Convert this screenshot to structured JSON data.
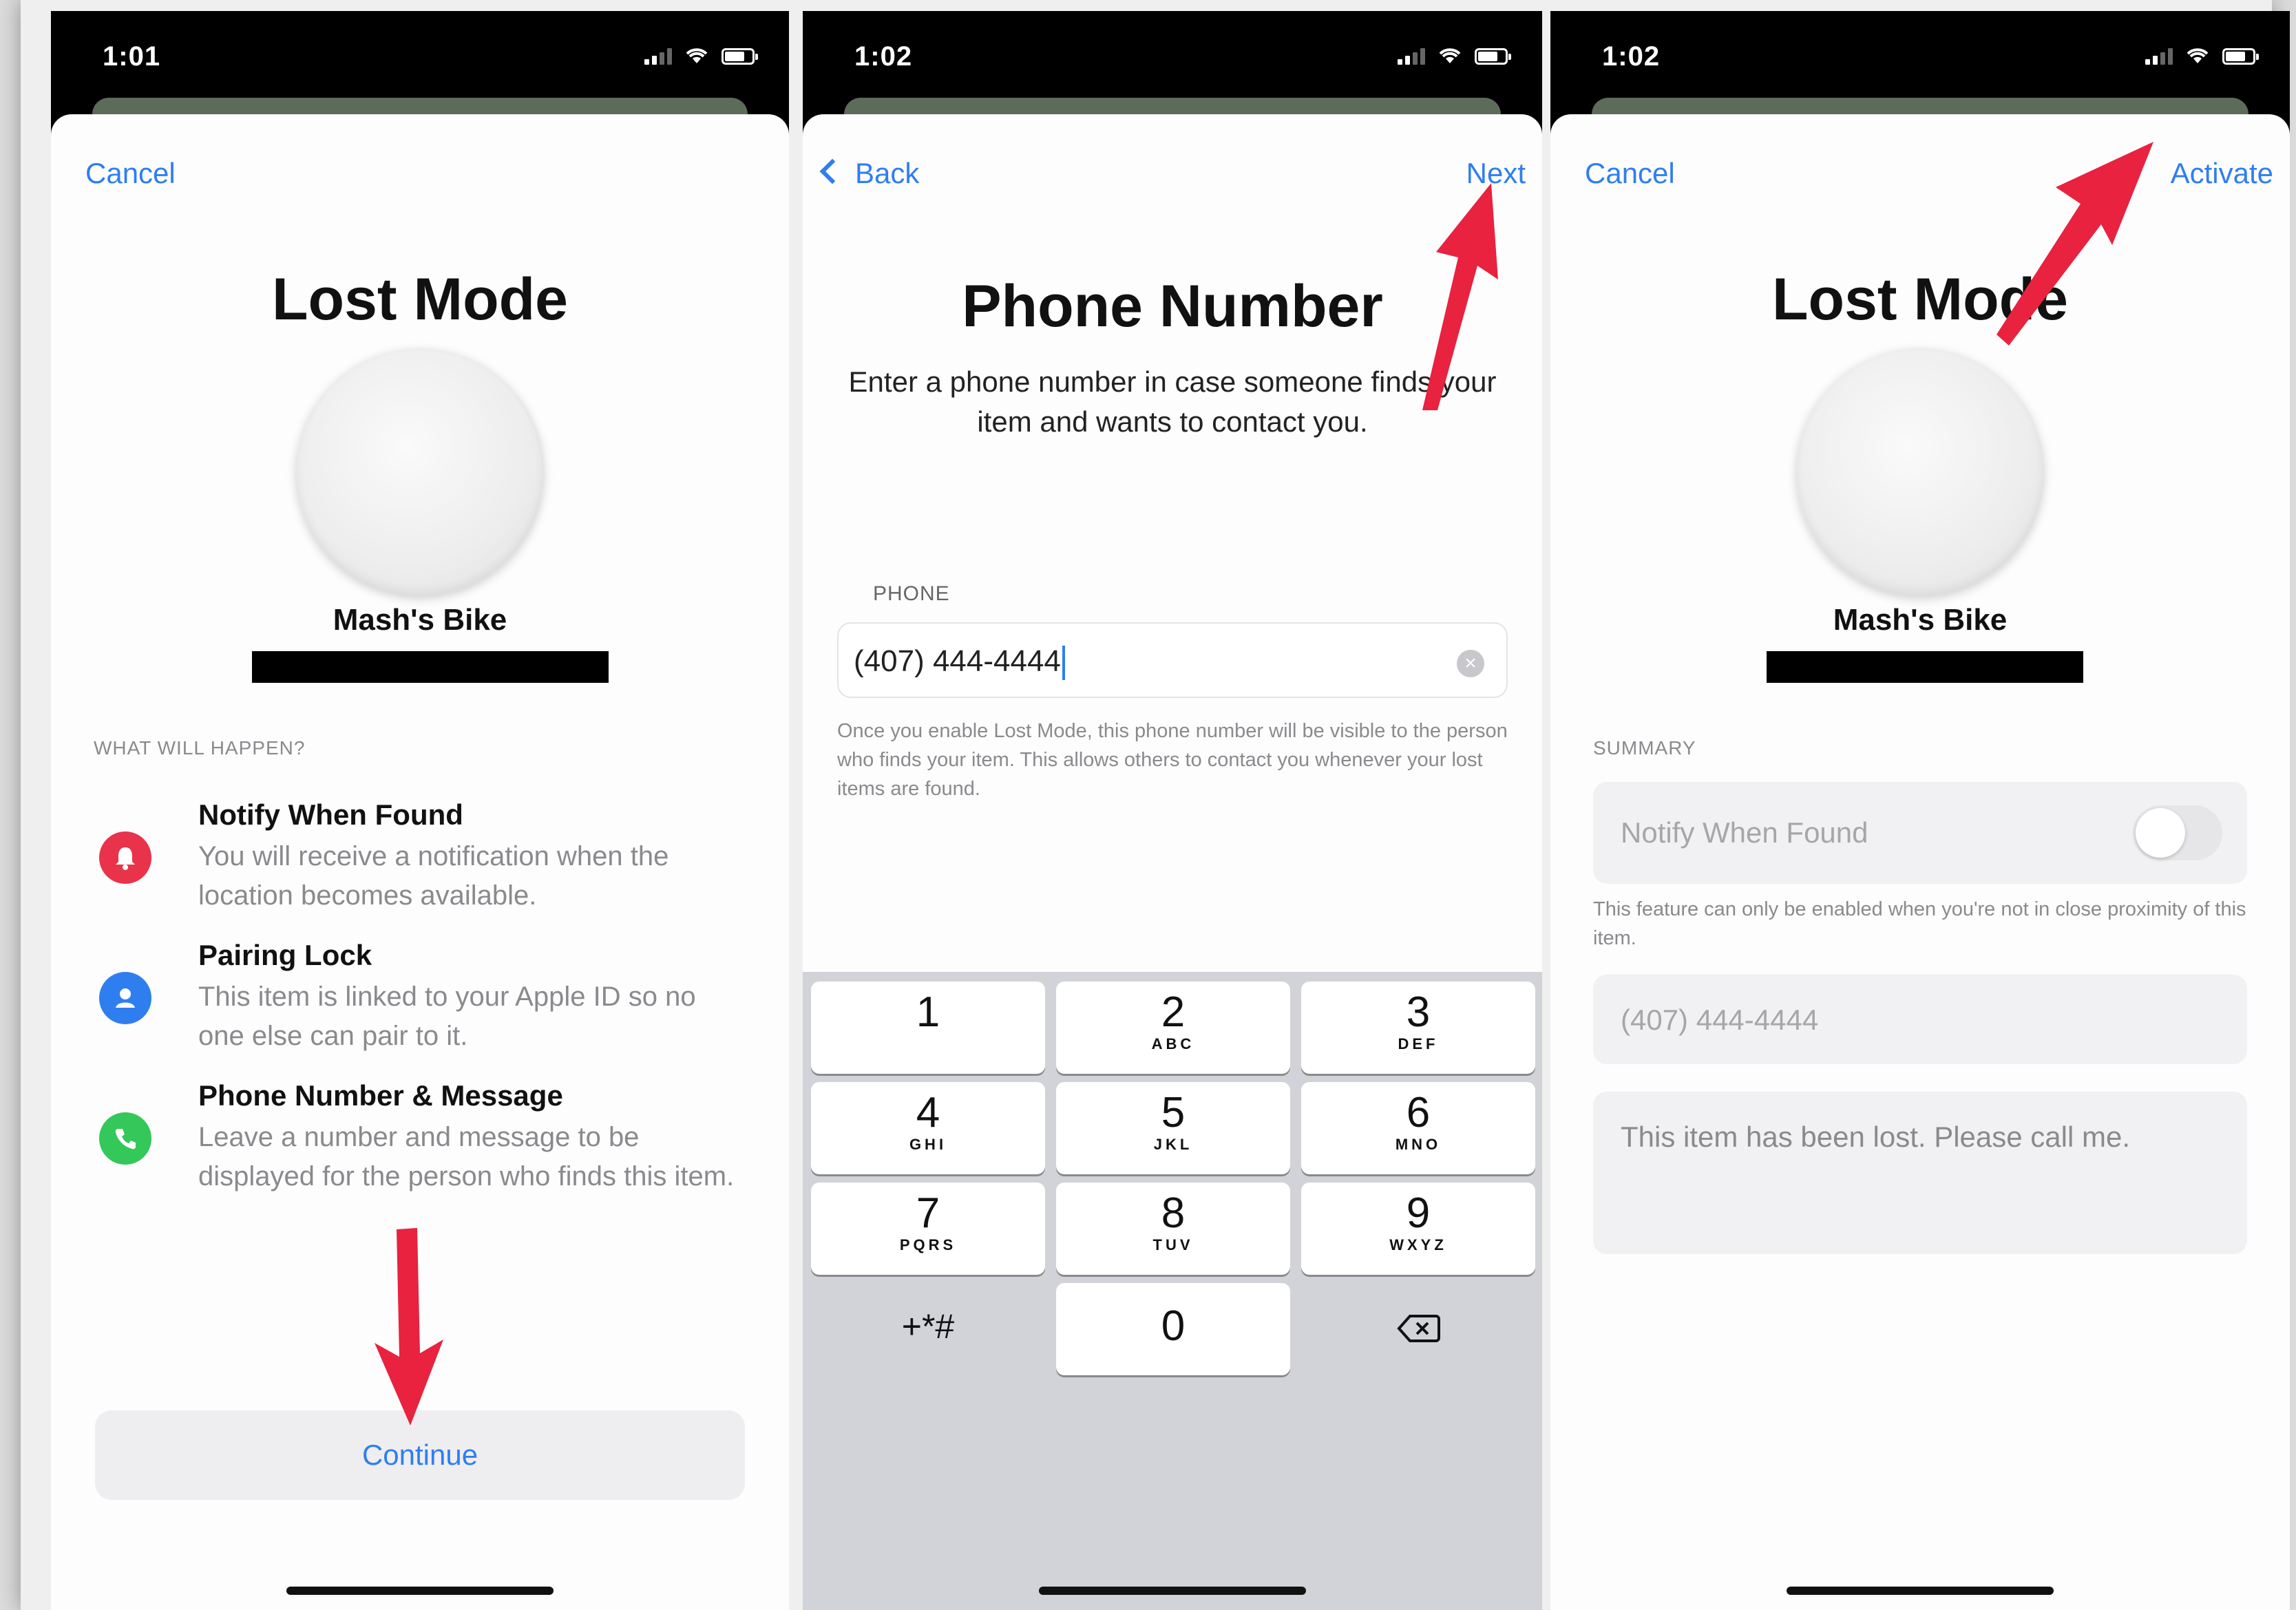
{
  "screen1": {
    "status_time": "1:01",
    "cancel_label": "Cancel",
    "title": "Lost Mode",
    "item_name": "Mash's Bike",
    "section_label": "WHAT WILL HAPPEN?",
    "features": [
      {
        "title": "Notify When Found",
        "desc": "You will receive a notification when the location becomes available.",
        "icon": "bell-icon",
        "color": "#e8334a"
      },
      {
        "title": "Pairing Lock",
        "desc": "This item is linked to your Apple ID so no one else can pair to it.",
        "icon": "person-icon",
        "color": "#2f7ef0"
      },
      {
        "title": "Phone Number & Message",
        "desc": "Leave a number and message to be displayed for the person who finds this item.",
        "icon": "phone-icon",
        "color": "#34c759"
      }
    ],
    "continue_label": "Continue"
  },
  "screen2": {
    "status_time": "1:02",
    "back_label": "Back",
    "next_label": "Next",
    "title": "Phone Number",
    "subtitle": "Enter a phone number in case someone finds your item and wants to contact you.",
    "field_label": "PHONE",
    "phone_value": "(407) 444-4444",
    "hint": "Once you enable Lost Mode, this phone number will be visible to the person who finds your item. This allows others to contact you whenever your lost items are found.",
    "keys": [
      {
        "num": "1",
        "letters": ""
      },
      {
        "num": "2",
        "letters": "ABC"
      },
      {
        "num": "3",
        "letters": "DEF"
      },
      {
        "num": "4",
        "letters": "GHI"
      },
      {
        "num": "5",
        "letters": "JKL"
      },
      {
        "num": "6",
        "letters": "MNO"
      },
      {
        "num": "7",
        "letters": "PQRS"
      },
      {
        "num": "8",
        "letters": "TUV"
      },
      {
        "num": "9",
        "letters": "WXYZ"
      },
      {
        "num": "+*#",
        "letters": ""
      },
      {
        "num": "0",
        "letters": ""
      },
      {
        "num": "⌫",
        "letters": ""
      }
    ]
  },
  "screen3": {
    "status_time": "1:02",
    "cancel_label": "Cancel",
    "activate_label": "Activate",
    "title": "Lost Mode",
    "item_name": "Mash's Bike",
    "section_label": "SUMMARY",
    "notify_label": "Notify When Found",
    "notify_enabled": false,
    "notify_hint": "This feature can only be enabled when you're not in close proximity of this item.",
    "phone_value": "(407) 444-4444",
    "message": "This item has been lost. Please call me."
  },
  "colors": {
    "accent": "#2f7ef0",
    "annotation_arrow": "#e8223f"
  }
}
